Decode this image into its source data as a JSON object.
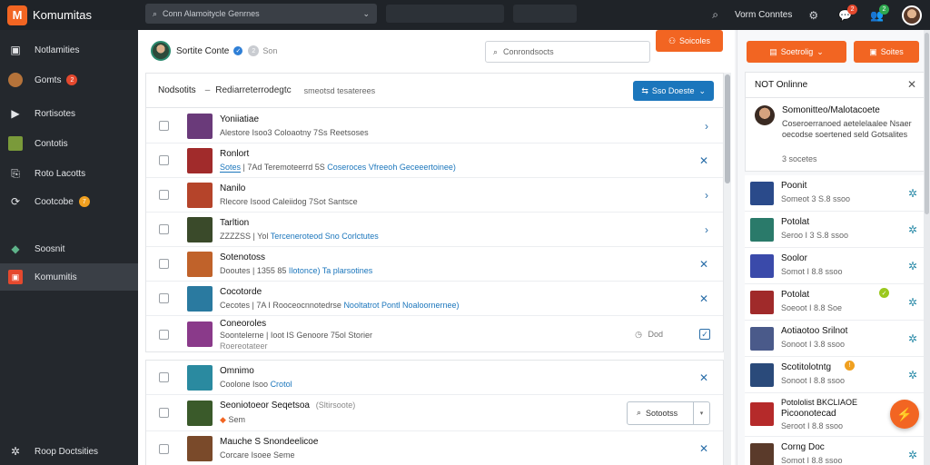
{
  "app": {
    "logo_letter": "M",
    "name": "Komumitas",
    "accent": "#f26522"
  },
  "top_search": {
    "text": "Conn Alamoitycle Genrnes"
  },
  "top_right": {
    "user_label": "Vorm Conntes",
    "badges": [
      "2",
      "2"
    ]
  },
  "sidebar": {
    "items": [
      {
        "icon": "add-square-icon",
        "label": "Notlamities",
        "badge": ""
      },
      {
        "icon": "avatar-icon",
        "label": "Gomts",
        "badge": "2"
      },
      {
        "icon": "play-icon",
        "label": "Rortisotes",
        "badge": ""
      },
      {
        "icon": "map-icon",
        "label": "Contotis",
        "badge": ""
      },
      {
        "icon": "share-icon",
        "label": "Roto Lacotts",
        "badge": ""
      },
      {
        "icon": "refresh-icon",
        "label": "Cootcobe",
        "badge": "7"
      },
      {
        "icon": "ticket-icon",
        "label": "Soosnit",
        "badge": ""
      },
      {
        "icon": "community-icon",
        "label": "Komumitis",
        "badge": ""
      }
    ],
    "footer": "Roop Doctsities"
  },
  "profile": {
    "name": "Sortite Conte",
    "sub": "Son",
    "sub_badge": "2"
  },
  "main_search": {
    "text": "Conrondsocts"
  },
  "main_button": {
    "label": "Soicoles"
  },
  "list": {
    "title": "Nodsotits",
    "sep": "–",
    "crumb": "Rediarreterrodegtc",
    "count": "smeotsd tesaterees",
    "action_label": "Sso Doeste",
    "rows": [
      {
        "title": "Yoniiatiae",
        "sub": "Alestore Isoo3 Coloaotny 7Ss Reetsoses",
        "hl": "",
        "thumb": "#6a3a7a",
        "action": "›",
        "extra": ""
      },
      {
        "title": "Ronlort",
        "sub": "| 7Ad Teremoteerrd 5S",
        "tag": "Sotes",
        "hl": "Coseroces Vfreeoh Geceeertoinee)",
        "thumb": "#a12b2b",
        "action": "✕",
        "extra": ""
      },
      {
        "title": "Nanilo",
        "sub": "Rlecore Isood Caleiidog 7Sot Santsce",
        "hl": "",
        "thumb": "#b5442a",
        "action": "›",
        "extra": ""
      },
      {
        "title": "Tarltion",
        "sub": "ZZZZSS | Yol",
        "hl": "Terceneroteod Sno Corlctutes",
        "thumb": "#3a4a2a",
        "action": "›",
        "extra": ""
      },
      {
        "title": "Sotenotoss",
        "sub": "Dooutes | 1355 85",
        "hl": "Ilotonce) Ta plarsotines",
        "thumb": "#c0622a",
        "action": "✕",
        "extra": ""
      },
      {
        "title": "Cocotorde",
        "sub": "Cecotes | 7A I Rooceocnnotedrse",
        "hl": "Nooltatrot Pontl Noaloornernee)",
        "thumb": "#2a7aa0",
        "action": "✕",
        "extra": ""
      },
      {
        "title": "Coneoroles",
        "sub": "Soontelerne | Ioot IS Genoore 75ol Storier",
        "sub2": "Roereotateer",
        "hl": "",
        "thumb": "#8a3a8a",
        "action": "☑",
        "extra": "Dod"
      }
    ],
    "rows2": [
      {
        "title": "Omnimo",
        "sub": "Coolone Isoo",
        "hl": "Crotol",
        "thumb": "#2a8aa0",
        "action": "✕"
      },
      {
        "title": "Seoniotoeor Seqetsoa",
        "sub_muted": "(Sltirsoote)",
        "sub": "Sem",
        "thumb": "#3a5a2a",
        "action": "",
        "button": "Sotootss"
      },
      {
        "title": "Mauche S Snondeelicoe",
        "sub": "Corcare Isoee Seme",
        "hl": "",
        "thumb": "#7a4a2a",
        "action": "✕"
      }
    ]
  },
  "right_panel": {
    "btn1": "Soetrolig",
    "btn2": "Soites",
    "notification": {
      "title": "NOT Onlinne",
      "name": "Somonitteo/Malotacoete",
      "text": "Coseroerranoed aetelelaalee Nsaer oecodse soertened seld Gotsalites",
      "meta": "3 socetes"
    },
    "friends": [
      {
        "name": "Poonit",
        "status": "Someot 3 S.8 ssoo",
        "color": "#2a4a8a",
        "dot": ""
      },
      {
        "name": "Potolat",
        "status": "Seroo I 3 S.8 ssoo",
        "color": "#2a7a6a",
        "dot": ""
      },
      {
        "name": "Soolor",
        "status": "Somot I 8.8 ssoo",
        "color": "#3a4aaa",
        "dot": ""
      },
      {
        "name": "Potolat",
        "status": "Soeoot I 8.8 Soe",
        "color": "#a02a2a",
        "dot": "#9ac81e"
      },
      {
        "name": "Aotiaotoo Srilnot",
        "status": "Sonoot I 3.8 ssoo",
        "color": "#4a5a8a",
        "dot": ""
      },
      {
        "name": "Scotitolotntg",
        "status": "Sonoot I 8.8 ssoo",
        "color": "#2a4a7a",
        "dot": "#f0a020"
      },
      {
        "name": "Potololist BKCLIAOE",
        "name2": "Picoonotecad",
        "status": "Seroot I 8.8 ssoo",
        "color": "#b52a2a",
        "dot": ""
      },
      {
        "name": "Corng Doc",
        "status": "Somot I 8.8 ssoo",
        "color": "#5a3a2a",
        "dot": ""
      }
    ]
  }
}
